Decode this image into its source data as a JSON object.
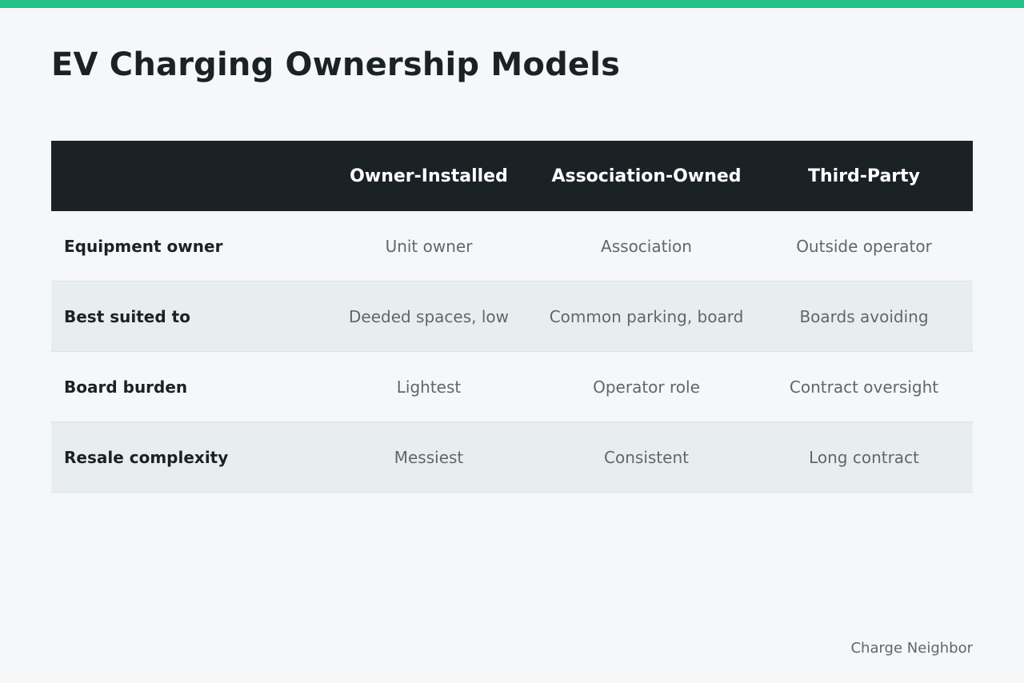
{
  "title": "EV Charging Ownership Models",
  "table": {
    "columns": [
      "Owner-Installed",
      "Association-Owned",
      "Third-Party"
    ],
    "rows": [
      {
        "label": "Equipment owner",
        "values": [
          "Unit owner",
          "Association",
          "Outside operator"
        ]
      },
      {
        "label": "Best suited to",
        "values": [
          "Deeded spaces, low",
          "Common parking, board",
          "Boards avoiding"
        ]
      },
      {
        "label": "Board burden",
        "values": [
          "Lightest",
          "Operator role",
          "Contract oversight"
        ]
      },
      {
        "label": "Resale complexity",
        "values": [
          "Messiest",
          "Consistent",
          "Long contract"
        ]
      }
    ]
  },
  "footer": {
    "brand": "Charge Neighbor"
  },
  "colors": {
    "accent": "#22c28a",
    "header_bg": "#1b2226",
    "page_bg": "#f5f7f9",
    "alt_row_bg": "#e8eeee"
  }
}
